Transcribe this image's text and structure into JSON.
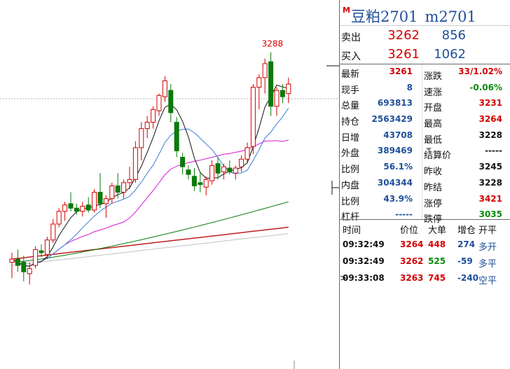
{
  "header": {
    "m_icon": "M",
    "name": "豆粕2701",
    "code": "m2701"
  },
  "orderbook": {
    "ask": {
      "label": "卖出",
      "price": "3262",
      "volume": "856"
    },
    "bid": {
      "label": "买入",
      "price": "3261",
      "volume": "1062"
    }
  },
  "stats": [
    {
      "l1": "最新",
      "v1": "3261",
      "c1": "red",
      "l2": "涨跌",
      "v2": "33/1.02%",
      "c2": "red"
    },
    {
      "l1": "现手",
      "v1": "8",
      "c1": "blue",
      "l2": "速涨",
      "v2": "-0.06%",
      "c2": "green"
    },
    {
      "l1": "总量",
      "v1": "693813",
      "c1": "blue",
      "l2": "开盘",
      "v2": "3231",
      "c2": "red"
    },
    {
      "l1": "持仓",
      "v1": "2563429",
      "c1": "blue",
      "l2": "最高",
      "v2": "3264",
      "c2": "red"
    },
    {
      "l1": "日增",
      "v1": "43708",
      "c1": "blue",
      "l2": "最低",
      "v2": "3228",
      "c2": "black"
    },
    {
      "l1": "外盘",
      "v1": "389469",
      "c1": "blue",
      "l2": "结算价",
      "v2": "-----",
      "c2": "black",
      "dropdown": true
    },
    {
      "l1": "比例",
      "v1": "56.1%",
      "c1": "blue",
      "l2": "昨收",
      "v2": "3245",
      "c2": "black"
    },
    {
      "l1": "内盘",
      "v1": "304344",
      "c1": "blue",
      "l2": "昨结",
      "v2": "3228",
      "c2": "black"
    },
    {
      "l1": "比例",
      "v1": "43.9%",
      "c1": "blue",
      "l2": "涨停",
      "v2": "3421",
      "c2": "red"
    },
    {
      "l1": "杠杆",
      "v1": "-----",
      "c1": "blue",
      "l2": "跌停",
      "v2": "3035",
      "c2": "green"
    }
  ],
  "trades": {
    "headers": [
      "时间",
      "价位",
      "大单",
      "增仓",
      "开平"
    ],
    "rows": [
      {
        "time": "09:32:49",
        "price": "3264",
        "vol": "448",
        "vol_color": "red",
        "oi": "274",
        "type": "多开",
        "marker": ""
      },
      {
        "time": "09:32:49",
        "price": "3262",
        "vol": "525",
        "vol_color": "green",
        "oi": "-59",
        "type": "多平",
        "marker": ""
      },
      {
        "time": "09:33:08",
        "price": "3263",
        "vol": "745",
        "vol_color": "red",
        "oi": "-240",
        "type": "空平",
        "marker": ">"
      }
    ]
  },
  "chart_data": {
    "type": "candlestick",
    "high_label": "3288",
    "colors": {
      "up": "#d40000",
      "down": "#0a7a0a",
      "ma5": "#111111",
      "ma10": "#3a7dd8",
      "ma20": "#d01ad0",
      "ma60": "#0a7a0a",
      "ma120": "#c02020",
      "ma250": "#999999"
    },
    "price_range": [
      2880,
      3320
    ],
    "candles": [
      {
        "o": 2930,
        "h": 2945,
        "l": 2905,
        "c": 2935
      },
      {
        "o": 2935,
        "h": 2950,
        "l": 2915,
        "c": 2925
      },
      {
        "o": 2930,
        "h": 2940,
        "l": 2900,
        "c": 2915
      },
      {
        "o": 2912,
        "h": 2930,
        "l": 2895,
        "c": 2920
      },
      {
        "o": 2925,
        "h": 2955,
        "l": 2920,
        "c": 2950
      },
      {
        "o": 2948,
        "h": 2958,
        "l": 2938,
        "c": 2945
      },
      {
        "o": 2942,
        "h": 2970,
        "l": 2935,
        "c": 2965
      },
      {
        "o": 2965,
        "h": 2998,
        "l": 2960,
        "c": 2990
      },
      {
        "o": 2990,
        "h": 3015,
        "l": 2985,
        "c": 3010
      },
      {
        "o": 3010,
        "h": 3025,
        "l": 2995,
        "c": 3020
      },
      {
        "o": 3022,
        "h": 3040,
        "l": 3010,
        "c": 3015
      },
      {
        "o": 3015,
        "h": 3022,
        "l": 3005,
        "c": 3010
      },
      {
        "o": 3010,
        "h": 3025,
        "l": 3002,
        "c": 3018
      },
      {
        "o": 3020,
        "h": 3032,
        "l": 3008,
        "c": 3012
      },
      {
        "o": 3012,
        "h": 3045,
        "l": 3008,
        "c": 3040
      },
      {
        "o": 3040,
        "h": 3070,
        "l": 3015,
        "c": 3022
      },
      {
        "o": 3022,
        "h": 3035,
        "l": 3000,
        "c": 3030
      },
      {
        "o": 3030,
        "h": 3055,
        "l": 3022,
        "c": 3050
      },
      {
        "o": 3050,
        "h": 3070,
        "l": 3030,
        "c": 3040
      },
      {
        "o": 3040,
        "h": 3060,
        "l": 3030,
        "c": 3055
      },
      {
        "o": 3055,
        "h": 3080,
        "l": 3045,
        "c": 3060
      },
      {
        "o": 3060,
        "h": 3120,
        "l": 3055,
        "c": 3110
      },
      {
        "o": 3110,
        "h": 3150,
        "l": 3090,
        "c": 3140
      },
      {
        "o": 3140,
        "h": 3160,
        "l": 3125,
        "c": 3150
      },
      {
        "o": 3150,
        "h": 3175,
        "l": 3140,
        "c": 3170
      },
      {
        "o": 3168,
        "h": 3195,
        "l": 3160,
        "c": 3192
      },
      {
        "o": 3190,
        "h": 3222,
        "l": 3182,
        "c": 3215
      },
      {
        "o": 3200,
        "h": 3210,
        "l": 3150,
        "c": 3165
      },
      {
        "o": 3150,
        "h": 3158,
        "l": 3095,
        "c": 3105
      },
      {
        "o": 3095,
        "h": 3102,
        "l": 3068,
        "c": 3080
      },
      {
        "o": 3075,
        "h": 3082,
        "l": 3060,
        "c": 3068
      },
      {
        "o": 3065,
        "h": 3078,
        "l": 3042,
        "c": 3050
      },
      {
        "o": 3055,
        "h": 3072,
        "l": 3040,
        "c": 3052
      },
      {
        "o": 3048,
        "h": 3065,
        "l": 3035,
        "c": 3060
      },
      {
        "o": 3058,
        "h": 3090,
        "l": 3052,
        "c": 3082
      },
      {
        "o": 3085,
        "h": 3095,
        "l": 3060,
        "c": 3070
      },
      {
        "o": 3072,
        "h": 3085,
        "l": 3060,
        "c": 3080
      },
      {
        "o": 3078,
        "h": 3090,
        "l": 3068,
        "c": 3072
      },
      {
        "o": 3070,
        "h": 3082,
        "l": 3060,
        "c": 3078
      },
      {
        "o": 3080,
        "h": 3098,
        "l": 3072,
        "c": 3092
      },
      {
        "o": 3092,
        "h": 3118,
        "l": 3085,
        "c": 3110
      },
      {
        "o": 3112,
        "h": 3210,
        "l": 3100,
        "c": 3205
      },
      {
        "o": 3205,
        "h": 3225,
        "l": 3170,
        "c": 3220
      },
      {
        "o": 3220,
        "h": 3250,
        "l": 3195,
        "c": 3242
      },
      {
        "o": 3245,
        "h": 3260,
        "l": 3160,
        "c": 3175
      },
      {
        "o": 3175,
        "h": 3205,
        "l": 3160,
        "c": 3200
      },
      {
        "o": 3200,
        "h": 3210,
        "l": 3180,
        "c": 3190
      },
      {
        "o": 3195,
        "h": 3220,
        "l": 3180,
        "c": 3210
      }
    ]
  }
}
